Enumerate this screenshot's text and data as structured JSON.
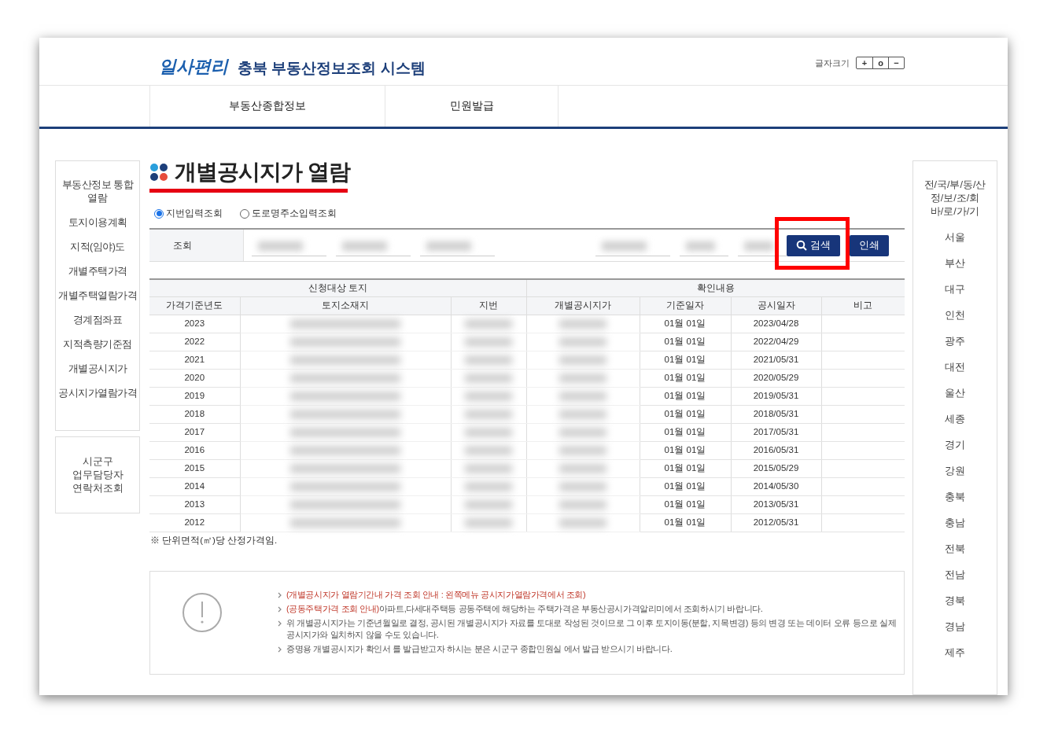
{
  "header": {
    "logo_mark": "일사편리",
    "site_title": "충북 부동산정보조회 시스템",
    "font_size_label": "글자크기",
    "font_size_buttons": [
      "+",
      "o",
      "−"
    ]
  },
  "nav": [
    {
      "label": "부동산종합정보",
      "selected": false
    },
    {
      "label": "민원발급",
      "selected": false
    }
  ],
  "left_menu": [
    "부동산정보 통합\n열람",
    "토지이용계획",
    "지적(임야)도",
    "개별주택가격",
    "개별주택열람가격",
    "경계점좌표",
    "지적측량기준점",
    "개별공시지가",
    "공시지가열람가격"
  ],
  "contact_box": "시군구\n업무담당자\n연락처조회",
  "page_title": "개별공시지가 열람",
  "search_modes": [
    {
      "label": "지번입력조회",
      "selected": true
    },
    {
      "label": "도로명주소입력조회",
      "selected": false
    }
  ],
  "search": {
    "label": "조회",
    "fields": [
      {
        "blurred": true
      },
      {
        "blurred": true
      },
      {
        "blurred": true
      },
      {
        "blurred": true
      },
      {
        "blurred": true
      },
      {
        "blurred": true
      }
    ],
    "search_button": "검색",
    "print_button": "인쇄",
    "highlighted": true
  },
  "table": {
    "groups": [
      "신청대상 토지",
      "확인내용"
    ],
    "columns": [
      "가격기준년도",
      "토지소재지",
      "지번",
      "개별공시지가",
      "기준일자",
      "공시일자",
      "비고"
    ],
    "rows": [
      {
        "year": "2023",
        "redacted": true,
        "base_date": "01월 01일",
        "notice_date": "2023/04/28"
      },
      {
        "year": "2022",
        "redacted": true,
        "base_date": "01월 01일",
        "notice_date": "2022/04/29"
      },
      {
        "year": "2021",
        "redacted": true,
        "base_date": "01월 01일",
        "notice_date": "2021/05/31"
      },
      {
        "year": "2020",
        "redacted": true,
        "base_date": "01월 01일",
        "notice_date": "2020/05/29"
      },
      {
        "year": "2019",
        "redacted": true,
        "base_date": "01월 01일",
        "notice_date": "2019/05/31"
      },
      {
        "year": "2018",
        "redacted": true,
        "base_date": "01월 01일",
        "notice_date": "2018/05/31"
      },
      {
        "year": "2017",
        "redacted": true,
        "base_date": "01월 01일",
        "notice_date": "2017/05/31"
      },
      {
        "year": "2016",
        "redacted": true,
        "base_date": "01월 01일",
        "notice_date": "2016/05/31"
      },
      {
        "year": "2015",
        "redacted": true,
        "base_date": "01월 01일",
        "notice_date": "2015/05/29"
      },
      {
        "year": "2014",
        "redacted": true,
        "base_date": "01월 01일",
        "notice_date": "2014/05/30"
      },
      {
        "year": "2013",
        "redacted": true,
        "base_date": "01월 01일",
        "notice_date": "2013/05/31"
      },
      {
        "year": "2012",
        "redacted": true,
        "base_date": "01월 01일",
        "notice_date": "2012/05/31"
      }
    ]
  },
  "table_note": "※ 단위면적(㎡)당 산정가격임.",
  "notices": [
    {
      "text": "(개별공시지가 열람기간내 가격 조회 안내 : 왼쪽메뉴 공시지가열람가격에서 조회)",
      "kind": "alert"
    },
    {
      "text": "(공동주택가격 조회 안내)아파트,다세대주택등 공동주택에 해당하는 주택가격은 부동산공시가격알리미에서 조회하시기 바랍니다.",
      "kind": "mixed"
    },
    {
      "text": "위 개별공시지가는 기준년월일로 결정, 공시된 개별공시지가 자료를 토대로 작성된 것이므로 그 이후 토지이동(분할, 지목변경) 등의 변경 또는 데이터 오류 등으로 실제 공시지가와 일치하지 않을 수도 있습니다.",
      "kind": "plain"
    },
    {
      "text": "증명용 개별공시지가 확인서 를 발급받고자 하시는 분은 시군구 종합민원실 에서 발급 받으시기 바랍니다.",
      "kind": "plain"
    }
  ],
  "right_menu": [
    "전/국/부/동/산\n정/보/조/회\n바/로/가/기",
    "서울",
    "부산",
    "대구",
    "인천",
    "광주",
    "대전",
    "울산",
    "세종",
    "경기",
    "강원",
    "충북",
    "충남",
    "전북",
    "전남",
    "경북",
    "경남",
    "제주"
  ]
}
